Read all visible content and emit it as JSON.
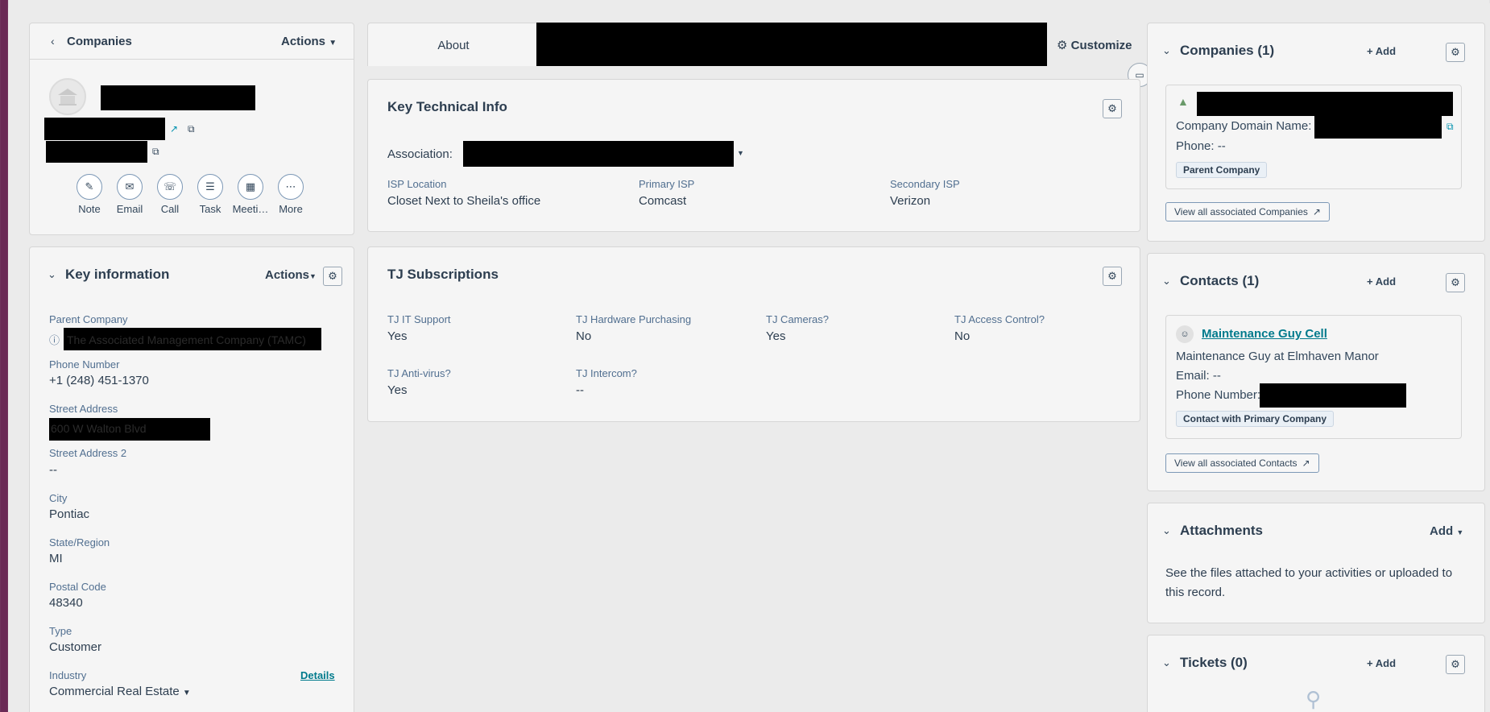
{
  "left_panel": {
    "back_label": "Companies",
    "actions_label": "Actions",
    "quick_actions": [
      {
        "label": "Note",
        "icon": "note-icon"
      },
      {
        "label": "Email",
        "icon": "email-icon"
      },
      {
        "label": "Call",
        "icon": "call-icon"
      },
      {
        "label": "Task",
        "icon": "task-icon"
      },
      {
        "label": "Meeti…",
        "icon": "meeting-icon"
      },
      {
        "label": "More",
        "icon": "more-icon"
      }
    ]
  },
  "key_info": {
    "title": "Key information",
    "actions_label": "Actions",
    "fields": {
      "parent_company_label": "Parent Company",
      "parent_company_value": "The Associated Management Company (TAMC)",
      "phone_label": "Phone Number",
      "phone_value": "+1 (248) 451-1370",
      "street_label": "Street Address",
      "street_value": "600 W Walton Blvd",
      "street2_label": "Street Address 2",
      "street2_value": "--",
      "city_label": "City",
      "city_value": "Pontiac",
      "state_label": "State/Region",
      "state_value": "MI",
      "postal_label": "Postal Code",
      "postal_value": "48340",
      "type_label": "Type",
      "type_value": "Customer",
      "industry_label": "Industry",
      "industry_value": "Commercial Real Estate",
      "details_link": "Details"
    }
  },
  "tabs": {
    "about": "About",
    "customize": "Customize"
  },
  "key_technical": {
    "title": "Key Technical Info",
    "association_label": "Association:",
    "isp_location_label": "ISP Location",
    "isp_location_value": "Closet Next to Sheila's office",
    "primary_isp_label": "Primary ISP",
    "primary_isp_value": "Comcast",
    "secondary_isp_label": "Secondary ISP",
    "secondary_isp_value": "Verizon"
  },
  "subscriptions": {
    "title": "TJ Subscriptions",
    "items": [
      {
        "label": "TJ IT Support",
        "value": "Yes"
      },
      {
        "label": "TJ Hardware Purchasing",
        "value": "No"
      },
      {
        "label": "TJ Cameras?",
        "value": "Yes"
      },
      {
        "label": "TJ Access Control?",
        "value": "No"
      },
      {
        "label": "TJ Anti-virus?",
        "value": "Yes"
      },
      {
        "label": "TJ Intercom?",
        "value": "--"
      }
    ]
  },
  "right_panel": {
    "companies": {
      "title": "Companies (1)",
      "add": "Add",
      "domain_label": "Company Domain Name:",
      "phone_label": "Phone:",
      "phone_value": "--",
      "pill": "Parent Company",
      "view_all": "View all associated Companies"
    },
    "contacts": {
      "title": "Contacts (1)",
      "add": "Add",
      "name": "Maintenance Guy Cell",
      "subtitle": "Maintenance Guy at Elmhaven Manor",
      "email_label": "Email:",
      "email_value": "--",
      "phone_label": "Phone Number:",
      "pill": "Contact with Primary Company",
      "view_all": "View all associated Contacts"
    },
    "attachments": {
      "title": "Attachments",
      "add": "Add",
      "text_line1": "See the files attached to your activities or uploaded to",
      "text_line2": "this record."
    },
    "tickets": {
      "title": "Tickets (0)",
      "add": "Add"
    }
  }
}
